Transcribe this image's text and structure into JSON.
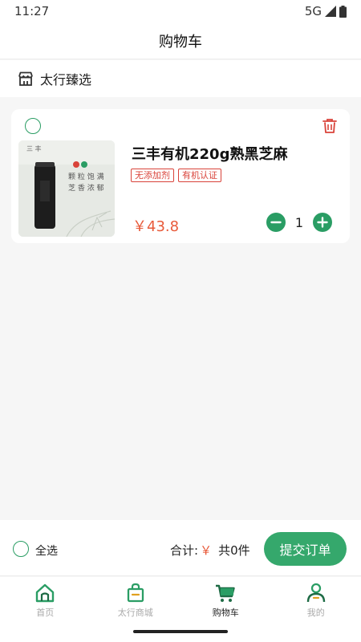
{
  "status_bar": {
    "time": "11:27",
    "network": "5G"
  },
  "header": {
    "title": "购物车"
  },
  "store": {
    "name": "太行臻选",
    "icon": "store-icon"
  },
  "cart_items": [
    {
      "name": "三丰有机220g熟黑芝麻",
      "tags": [
        "无添加剂",
        "有机认证"
      ],
      "price": "￥43.8",
      "quantity": "1",
      "image_text": {
        "brand": "三 丰",
        "line1": "颗 粒 饱 满",
        "line2": "芝 香 浓 郁"
      }
    }
  ],
  "footer": {
    "select_all_label": "全选",
    "total_label": "合计:",
    "currency": "￥",
    "count_text": "共0件",
    "submit_label": "提交订单"
  },
  "tabs": [
    {
      "label": "首页",
      "icon": "home-icon"
    },
    {
      "label": "太行商城",
      "icon": "shopping-bag-icon"
    },
    {
      "label": "购物车",
      "icon": "cart-icon",
      "active": true
    },
    {
      "label": "我的",
      "icon": "user-icon"
    }
  ],
  "colors": {
    "accent": "#2a9d64",
    "price": "#e85a3a",
    "tag": "#d9433a",
    "submit": "#35a86c"
  }
}
